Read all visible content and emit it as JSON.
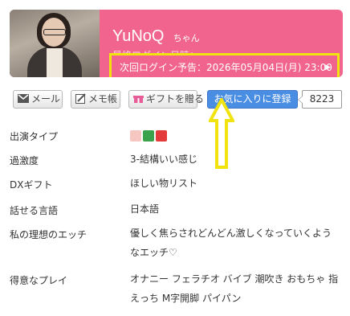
{
  "profile": {
    "name": "YuNoQ",
    "suffix": "ちゃん",
    "last_login_label": "最終ログイン日時：",
    "next_login": "次回ログイン予告：2026年05月04日(月) 23:00",
    "next_arrow": "▶"
  },
  "actions": {
    "mail": "メール",
    "memo": "メモ帳",
    "gift": "ギフトを贈る",
    "favorite": "お気に入りに登録",
    "favorite_count": "8223"
  },
  "details": [
    {
      "label": "出演タイプ",
      "value": ""
    },
    {
      "label": "過激度",
      "value": "3-結構いい感じ"
    },
    {
      "label": "DXギフト",
      "value": "ほしい物リスト"
    },
    {
      "label": "話せる言語",
      "value": "日本語"
    },
    {
      "label": "私の理想のエッチ",
      "value": "優しく焦らされどんどん激しくなっていくようなエッチ♡"
    },
    {
      "label": "得意なプレイ",
      "value": "オナニー フェラチオ バイブ 潮吹き おもちゃ 指えっち M字開脚 パイパン"
    }
  ],
  "colors": {
    "header": "#f0648e",
    "highlight": "#f0e310",
    "favorite": "#4a8ee3",
    "link": "#3a8fd0"
  },
  "icons": [
    "envelope-icon",
    "memo-icon",
    "gift-icon",
    "arrow-up-icon",
    "type-emoji-icons"
  ]
}
